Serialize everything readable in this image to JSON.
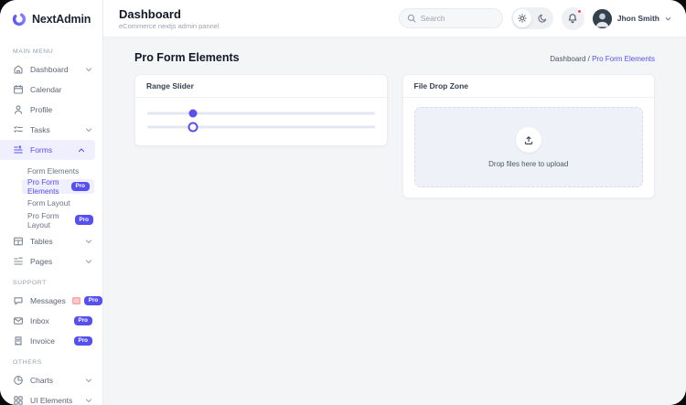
{
  "brand": {
    "name": "NextAdmin"
  },
  "header": {
    "title": "Dashboard",
    "subtitle": "eCommerce nextjs admin pannel",
    "search_placeholder": "Search",
    "user": {
      "name": "Jhon Smith"
    }
  },
  "sidebar": {
    "pro_badge": "Pro",
    "sections": [
      {
        "label": "MAIN MENU",
        "items": [
          {
            "label": "Dashboard"
          },
          {
            "label": "Calendar"
          },
          {
            "label": "Profile"
          },
          {
            "label": "Tasks"
          },
          {
            "label": "Forms",
            "active": true,
            "expanded": true
          },
          {
            "label": "Tables"
          },
          {
            "label": "Pages"
          }
        ]
      },
      {
        "label": "SUPPORT",
        "items": [
          {
            "label": "Messages",
            "badge": "Pro",
            "unread_dot": true
          },
          {
            "label": "Inbox",
            "badge": "Pro"
          },
          {
            "label": "Invoice",
            "badge": "Pro"
          }
        ]
      },
      {
        "label": "OTHERS",
        "items": [
          {
            "label": "Charts"
          },
          {
            "label": "UI Elements"
          }
        ]
      }
    ],
    "forms_submenu": [
      {
        "label": "Form Elements"
      },
      {
        "label": "Pro Form Elements",
        "badge": "Pro",
        "active": true
      },
      {
        "label": "Form Layout"
      },
      {
        "label": "Pro Form Layout",
        "badge": "Pro"
      }
    ]
  },
  "page": {
    "title": "Pro Form Elements",
    "breadcrumb": {
      "root": "Dashboard",
      "separator": " / ",
      "current": "Pro Form Elements"
    }
  },
  "cards": {
    "range_slider": {
      "title": "Range Slider",
      "slider1_percent": 20,
      "slider2_percent": 20
    },
    "file_drop_zone": {
      "title": "File Drop Zone",
      "drop_text": "Drop files here to upload"
    }
  },
  "colors": {
    "accent": "#5750f1",
    "page_bg": "#f3f5f7"
  }
}
